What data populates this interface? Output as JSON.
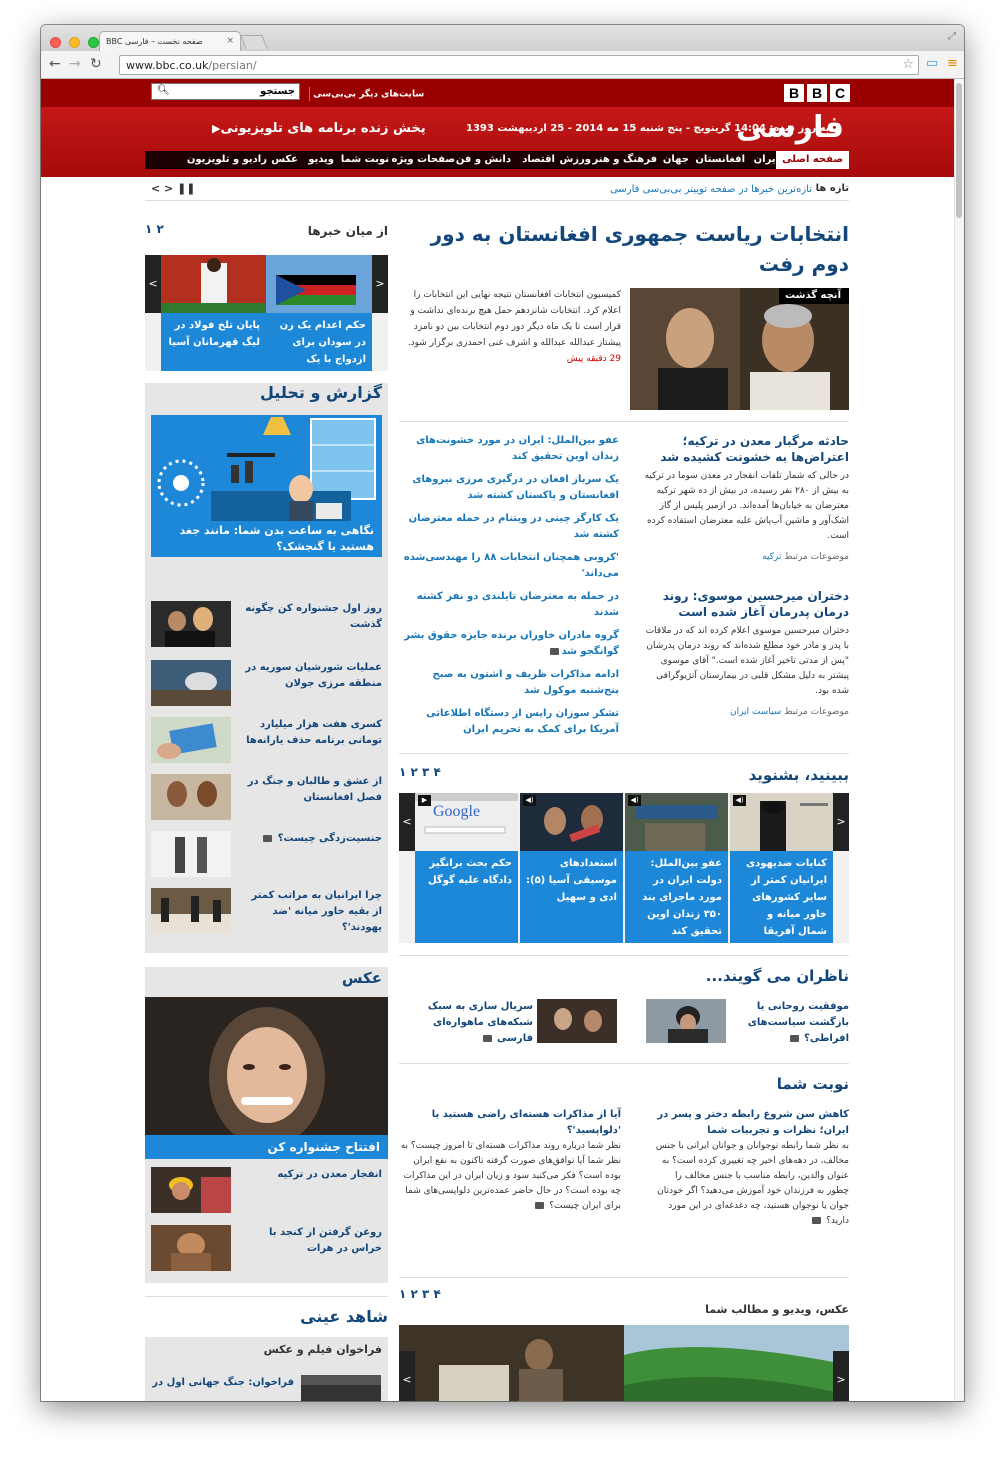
{
  "browser": {
    "tab_title": "BBC صفحه نخست – فارسی",
    "tab_close": "×",
    "url_host": "www.bbc.co.uk",
    "url_path": "/persian/"
  },
  "header": {
    "search_label": "جستجو",
    "other_sites": "سایت‌های دیگر بی‌بی‌سی",
    "logo_letters": [
      "B",
      "B",
      "C"
    ],
    "service_name": "فارسی",
    "dateline": "به روز شده: 14:04 گرینویچ - پنج شنبه 15 مه 2014 - 25 اردیبهشت 1393",
    "live_tv": "پخش زنده برنامه های تلویزیونی"
  },
  "nav": {
    "items": [
      "صفحه اصلی",
      "ایران",
      "افغانستان",
      "جهان",
      "فرهنگ و هنر",
      "ورزش",
      "اقتصاد",
      "دانش و فن",
      "صفحات ویژه",
      "نوبت شما",
      "ویدیو",
      "عکس",
      "رادیو و تلویزیون"
    ]
  },
  "ticker": {
    "label": "تازه ها",
    "text": "تازه‌ترین خبرها در صفحه توییتر بی‌بی‌سی فارسی",
    "controls": "< > ❚❚"
  },
  "lead": {
    "headline": "انتخابات ریاست جمهوری افغانستان به دور دوم رفت",
    "tag": "آنچه گذشت",
    "summary": "کمیسیون انتخابات افغانستان نتیجه نهایی این انتخابات را اعلام کرد. انتخابات شانزدهم حمل هیچ برنده‌ای نداشت و قرار است تا یک ماه دیگر دور دوم انتخابات بین دو نامزد پیشتاز عبدالله عبدالله و اشرف غنی احمدزی برگزار شود.",
    "ago": "29 دقیقه پیش"
  },
  "stories": [
    {
      "title": "حادثه مرگبار معدن در ترکیه؛ اعتراض‌ها به خشونت کشیده شد",
      "summary": "در حالی که شمار تلفات انفجار در معدن سوما در ترکیه به بیش از ۲۸۰ نفر رسیده، در بیش از ده شهر ترکیه معترضان به خیابان‌ها آمده‌اند. در ازمیر پلیس از گاز اشک‌آور و ماشین آب‌پاش علیه معترضان استفاده کرده است.",
      "related_label": "موضوعات مرتبط",
      "related_link": "ترکیه"
    },
    {
      "title": "دختران میرحسین موسوی: روند درمان پدرمان آغاز شده است",
      "summary": "دختران میرحسین موسوی اعلام کرده اند که در ملاقات با پدر و مادر خود مطلع شده‌اند که روند درمان پدرشان \"پس از مدتی تاخیر آغاز شده است.\" آقای موسوی پیشتر به دلیل مشکل قلبی در بیمارستان آنژیوگرافی شده بود.",
      "related_label": "موضوعات مرتبط",
      "related_link": "سیاست ایران"
    }
  ],
  "links": [
    "عفو بین‌الملل: ایران در مورد خشونت‌های زندان اوین تحقیق کند",
    "یک سرباز افغان در درگیری مرزی نیروهای افغانستان و پاکستان کشته شد",
    "یک کارگر چینی در ویتنام در حمله معترضان کشته شد",
    "'کروبی همچنان انتخابات ۸۸ را مهندسی‌شده می‌داند'",
    "در حمله به معترضان تایلندی دو نفر کشته شدند",
    "گروه مادران خاوران برنده جایزه حقوق بشر گوانگجو شد",
    "ادامه مذاکرات ظریف و اشتون به صبح پنج‌شنبه موکول شد",
    "تشکر سوزان رایس از دستگاه اطلاعاتی آمریکا برای کمک به تحریم ایران"
  ],
  "watch": {
    "title": "ببینید، بشنوید",
    "pager": "۱ ۲ ۳ ۴",
    "items": [
      "کنایات ضدیهودی ایرانیان کمتر از سایر کشورهای خاور میانه و شمال آفریقا",
      "عفو بین‌الملل: دولت ایران در مورد ماجرای بند ۳۵۰ زندان اوین تحقیق کند",
      "استعداد‌های موسیقی آسیا (۵): ادی و سهیل",
      "حکم بحث برانگیز دادگاه علیه گوگل"
    ],
    "google_text": "Google"
  },
  "observers": {
    "title": "ناظران می گویند...",
    "items": [
      "موفقیت روحانی یا بازگشت سیاست‌های افراطی؟",
      "سریال سازی به سبک شبکه‌های ماهواره‌ای فارسی"
    ]
  },
  "your_turn": {
    "title": "نوبت شما",
    "items": [
      {
        "title": "کاهش سن شروع رابطه دختر و پسر در ایران؛ نظرات و تجربیات شما",
        "body": "به نظر شما رابطه نوجوانان و جوانان ایرانی با جنس مخالف، در دهه‌های اخیر چه تغییری کرده است؟ به عنوان والدین، رابطه مناسب با جنس مخالف را چطور به فرزندان خود آموزش می‌دهید؟ اگر خودتان جوان یا نوجوان هستید، چه دغدغه‌ای در این مورد دارید؟"
      },
      {
        "title": "آیا از مذاکرات هسته‌ای راضی هستید یا 'دلواپسید'؟",
        "body": "نظر شما درباره روند مذاکرات هسته‌ای تا امروز چیست؟ به نظر شما آیا توافق‌های صورت گرفته تاکنون به نفع ایران بوده است؟ فکر می‌کنید سود و زیان ایران در این مذاکرات چه بوده است؟ در حال حاضر عمده‌ترین دلواپسی‌های شما برای ایران چیست؟"
      }
    ]
  },
  "gallery": {
    "title": "عکس، ویدیو و مطالب شما",
    "pager": "۱ ۲ ۳ ۴"
  },
  "sidebar": {
    "news_title": "از میان خبرها",
    "news_pager": "۱ ۲",
    "news_items": [
      "حکم اعدام یک زن در سودان برای ازدواج با یک مسیحی",
      "پایان تلخ فولاد در لیگ قهرمانان آسیا"
    ],
    "analysis_title": "گزارش و تحلیل",
    "analysis_feature": "نگاهی به ساعت بدن شما: مانند جغد هستید یا گنجشک؟",
    "analysis_items": [
      "روز اول جشنواره کن چگونه گذشت",
      "عملیات شورشیان سوریه در منطقه مرزی جولان",
      "کسری هفت هزار میلیارد تومانی برنامه حذف یارانه‌ها",
      "از عشق و طالبان و جنگ در فصل افغانستان",
      "جنسیت‌زدگی چیست؟",
      "چرا ایرانیان به مراتب کمتر از بقیه خاور میانه 'ضد یهودند'؟"
    ],
    "photo_title": "عکس",
    "photo_caption": "افتتاح جشنواره کن",
    "photo_items": [
      "انفجار معدن در ترکیه",
      "روغن گرفتن از کنجد با خراس در هرات"
    ],
    "witness_title": "شاهد عینی",
    "witness_sub": "فراخوان فیلم و عکس",
    "witness_item": "فراخوان: جنگ جهانی اول در"
  },
  "colors": {
    "bbc_red": "#bb1111",
    "headline_blue": "#13467a",
    "link_blue": "#1776b8",
    "caption_blue": "#1e88d8"
  }
}
